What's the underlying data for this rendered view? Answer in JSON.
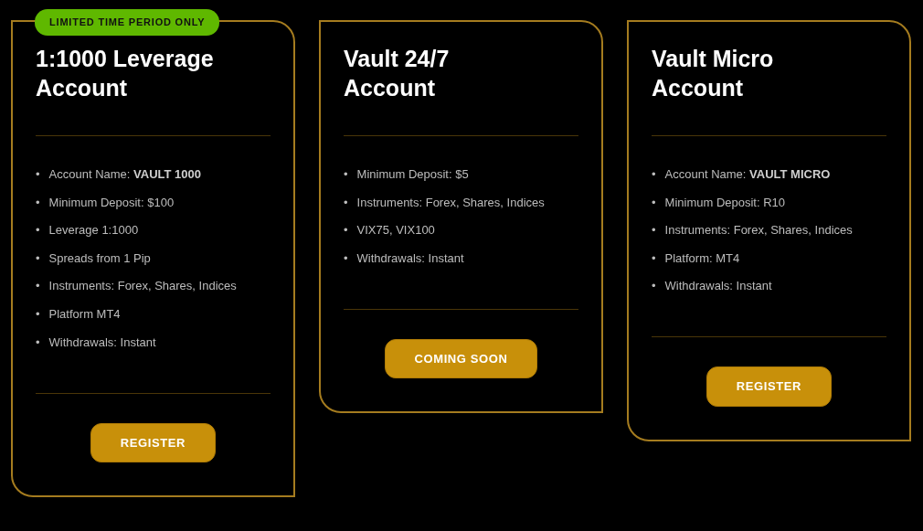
{
  "cards": [
    {
      "badge": "LIMITED TIME PERIOD ONLY",
      "title": "1:1000 Leverage Account",
      "features": [
        {
          "bullet": "•",
          "text": "Account Name: **VAULT 1000**"
        },
        {
          "bullet": "•",
          "text": "Minimum Deposit: $100"
        },
        {
          "bullet": "•",
          "text": "Leverage 1:1000"
        },
        {
          "bullet": "•",
          "text": "Spreads from 1 Pip"
        },
        {
          "bullet": "•",
          "text": "Instruments: Forex, Shares, Indices"
        },
        {
          "bullet": "•",
          "text": "Platform MT4"
        },
        {
          "bullet": "•",
          "text": "Withdrawals: Instant"
        }
      ],
      "button": "REGISTER"
    },
    {
      "title": "Vault 24/7 Account",
      "features": [
        {
          "bullet": "•",
          "text": "Minimum Deposit: $5"
        },
        {
          "bullet": "•",
          "text": "Instruments: Forex, Shares, Indices"
        },
        {
          "bullet": "•",
          "text": "VIX75, VIX100"
        },
        {
          "bullet": "•",
          "text": "Withdrawals: Instant"
        }
      ],
      "button": "COMING SOON"
    },
    {
      "title": "Vault Micro Account",
      "features": [
        {
          "bullet": "•",
          "text": "Account Name: **VAULT MICRO**"
        },
        {
          "bullet": "•",
          "text": "Minimum Deposit: R10"
        },
        {
          "bullet": "•",
          "text": "Instruments: Forex, Shares, Indices"
        },
        {
          "bullet": "•",
          "text": "Platform: MT4"
        },
        {
          "bullet": "•",
          "text": "Withdrawals: Instant"
        }
      ],
      "button": "REGISTER"
    }
  ]
}
